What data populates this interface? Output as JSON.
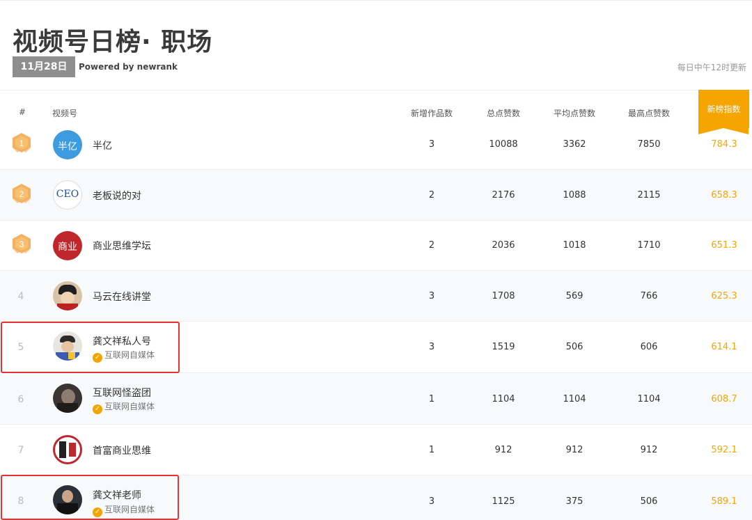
{
  "header": {
    "title": "视频号日榜· 职场",
    "date": "11月28日",
    "powered_by": "Powered by newrank",
    "update_note": "每日中午12时更新"
  },
  "columns": {
    "rank": "#",
    "account": "视频号",
    "new_works": "新增作品数",
    "total_likes": "总点赞数",
    "avg_likes": "平均点赞数",
    "max_likes": "最高点赞数",
    "index": "新榜指数"
  },
  "colors": {
    "accent": "#f6a500",
    "highlight": "#e8322f",
    "date_badge": "#8e8e8e"
  },
  "rows": [
    {
      "rank": "1",
      "name": "半亿",
      "avatar_text": "半亿",
      "new_works": "3",
      "total_likes": "10088",
      "avg_likes": "3362",
      "max_likes": "7850",
      "index": "784.3"
    },
    {
      "rank": "2",
      "name": "老板说的对",
      "avatar_text": "CEO",
      "new_works": "2",
      "total_likes": "2176",
      "avg_likes": "1088",
      "max_likes": "2115",
      "index": "658.3"
    },
    {
      "rank": "3",
      "name": "商业思维学坛",
      "avatar_text": "商业",
      "new_works": "2",
      "total_likes": "2036",
      "avg_likes": "1018",
      "max_likes": "1710",
      "index": "651.3"
    },
    {
      "rank": "4",
      "name": "马云在线讲堂",
      "new_works": "3",
      "total_likes": "1708",
      "avg_likes": "569",
      "max_likes": "766",
      "index": "625.3"
    },
    {
      "rank": "5",
      "name": "龚文祥私人号",
      "verified": "互联网自媒体",
      "new_works": "3",
      "total_likes": "1519",
      "avg_likes": "506",
      "max_likes": "606",
      "index": "614.1"
    },
    {
      "rank": "6",
      "name": "互联网怪盗团",
      "verified": "互联网自媒体",
      "new_works": "1",
      "total_likes": "1104",
      "avg_likes": "1104",
      "max_likes": "1104",
      "index": "608.7"
    },
    {
      "rank": "7",
      "name": "首富商业思维",
      "new_works": "1",
      "total_likes": "912",
      "avg_likes": "912",
      "max_likes": "912",
      "index": "592.1"
    },
    {
      "rank": "8",
      "name": "龚文祥老师",
      "verified": "互联网自媒体",
      "new_works": "3",
      "total_likes": "1125",
      "avg_likes": "375",
      "max_likes": "506",
      "index": "589.1"
    }
  ]
}
